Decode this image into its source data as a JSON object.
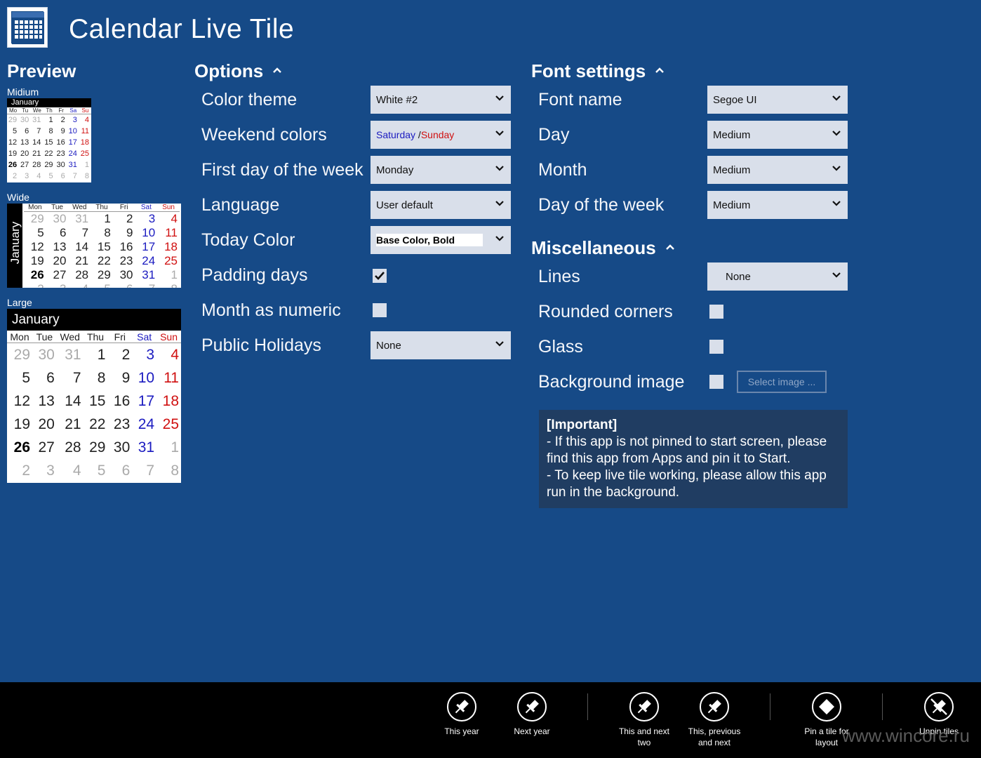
{
  "app": {
    "title": "Calendar Live Tile"
  },
  "preview": {
    "heading": "Preview",
    "medium_label": "Midium",
    "wide_label": "Wide",
    "large_label": "Large",
    "month": "January",
    "weekdays_short": [
      "Mo",
      "Tu",
      "We",
      "Th",
      "Fr",
      "Sa",
      "Su"
    ],
    "weekdays": [
      "Mon",
      "Tue",
      "Wed",
      "Thu",
      "Fri",
      "Sat",
      "Sun"
    ],
    "weeks": [
      [
        "29",
        "30",
        "31",
        "1",
        "2",
        "3",
        "4"
      ],
      [
        "5",
        "6",
        "7",
        "8",
        "9",
        "10",
        "11"
      ],
      [
        "12",
        "13",
        "14",
        "15",
        "16",
        "17",
        "18"
      ],
      [
        "19",
        "20",
        "21",
        "22",
        "23",
        "24",
        "25"
      ],
      [
        "26",
        "27",
        "28",
        "29",
        "30",
        "31",
        "1"
      ],
      [
        "2",
        "3",
        "4",
        "5",
        "6",
        "7",
        "8"
      ]
    ]
  },
  "options": {
    "heading": "Options",
    "rows": [
      {
        "label": "Color theme",
        "value": "White #2"
      },
      {
        "label": "Weekend colors",
        "value_a": "Saturday",
        "value_sep": " /",
        "value_b": "Sunday"
      },
      {
        "label": "First day of the week",
        "value": "Monday"
      },
      {
        "label": "Language",
        "value": "User default"
      },
      {
        "label": "Today Color",
        "value": "Base Color, Bold"
      },
      {
        "label": "Padding days",
        "checked": true
      },
      {
        "label": "Month as numeric",
        "checked": false
      },
      {
        "label": "Public Holidays",
        "value": "None"
      }
    ]
  },
  "font_settings": {
    "heading": "Font settings",
    "rows": [
      {
        "label": "Font name",
        "value": "Segoe UI"
      },
      {
        "label": "Day",
        "value": "Medium"
      },
      {
        "label": "Month",
        "value": "Medium"
      },
      {
        "label": "Day of the week",
        "value": "Medium"
      }
    ]
  },
  "misc": {
    "heading": "Miscellaneous",
    "rows": [
      {
        "label": "Lines",
        "value": "None"
      },
      {
        "label": "Rounded corners",
        "checked": false
      },
      {
        "label": "Glass",
        "checked": false
      },
      {
        "label": "Background image",
        "checked": false,
        "button": "Select image ..."
      }
    ]
  },
  "important": {
    "title": "[Important]",
    "line1": "- If this app is not pinned to start screen, please find this app from Apps and pin it to Start.",
    "line2": "- To keep live tile working, please allow this app run in the background."
  },
  "appbar": {
    "buttons": [
      {
        "label": "This year",
        "icon": "pin-icon"
      },
      {
        "label": "Next year",
        "icon": "pin-icon"
      },
      {
        "label": "This and next two",
        "icon": "pin-icon"
      },
      {
        "label": "This, previous and next",
        "icon": "pin-icon"
      },
      {
        "label": "Pin a tile for layout",
        "icon": "diamond-icon"
      },
      {
        "label": "Unpin tiles",
        "icon": "unpin-icon"
      }
    ]
  },
  "watermark": "www.wincore.ru",
  "colors": {
    "background": "#164a87",
    "saturday": "#1b1bc0",
    "sunday": "#d01010",
    "appbar": "#000000"
  }
}
